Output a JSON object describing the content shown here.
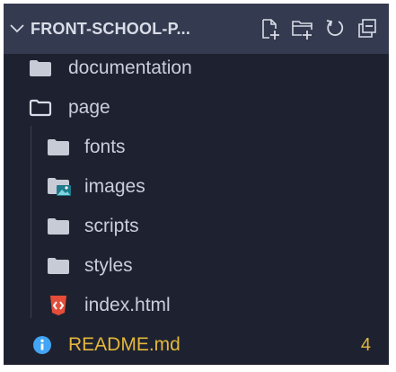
{
  "header": {
    "title": "FRONT-SCHOOL-P...",
    "collapse_icon": "chevron-down-icon",
    "actions": [
      "new-file-icon",
      "new-folder-icon",
      "refresh-icon",
      "collapse-all-icon"
    ]
  },
  "tree": {
    "documentation": {
      "label": "documentation",
      "icon": "folder-icon"
    },
    "page": {
      "label": "page",
      "icon": "folder-open-icon"
    },
    "fonts": {
      "label": "fonts",
      "icon": "folder-icon"
    },
    "images": {
      "label": "images",
      "icon": "folder-images-icon"
    },
    "scripts": {
      "label": "scripts",
      "icon": "folder-icon"
    },
    "styles": {
      "label": "styles",
      "icon": "folder-icon"
    },
    "index": {
      "label": "index.html",
      "icon": "html5-icon"
    },
    "readme": {
      "label": "README.md",
      "icon": "info-icon",
      "badge": "4"
    }
  },
  "colors": {
    "background": "#1e2230",
    "header": "#343a4f",
    "text": "#c9ceda",
    "modified": "#e4b73c",
    "folder": "#c7cbd6",
    "html": "#e44d3a",
    "info": "#42a5f5"
  }
}
